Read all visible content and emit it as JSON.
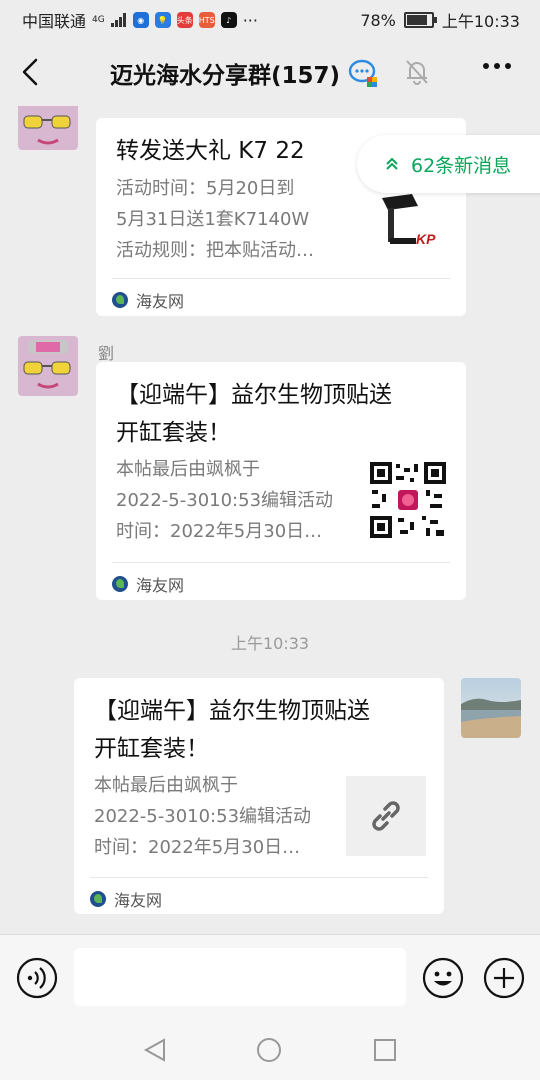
{
  "status_bar": {
    "carrier": "中国联通",
    "network": "4G",
    "app_icons": [
      "头条",
      "HTS"
    ],
    "more": "···",
    "battery_pct": "78%",
    "battery_level": 0.78,
    "time": "上午10:33"
  },
  "header": {
    "back_icon": "back-arrow-icon",
    "title": "迈光海水分享群(157)",
    "group_icon": "group-chat-icon",
    "mute_icon": "bell-off-icon",
    "more_icon": "more-dots-icon"
  },
  "new_messages": {
    "label": "62条新消息",
    "icon": "double-chevron-up-icon",
    "color": "#0aa65a"
  },
  "messages": [
    {
      "sender": "",
      "title": "转发送大礼 K7 22",
      "desc": [
        "活动时间：5月20日到",
        "5月31日送1套K7140W",
        "活动规则：把本贴活动…"
      ],
      "thumb_text": "KP",
      "source": "海友网"
    },
    {
      "sender": "劉",
      "title": [
        "【迎端午】益尔生物顶贴送",
        "开缸套装！"
      ],
      "desc": [
        "本帖最后由飒枫于",
        "2022-5-3010:53编辑活动",
        "时间：2022年5月30日…"
      ],
      "thumb": "qr-code",
      "source": "海友网"
    }
  ],
  "timestamp": "上午10:33",
  "my_message": {
    "title": [
      "【迎端午】益尔生物顶贴送",
      "开缸套装！"
    ],
    "desc": [
      "本帖最后由飒枫于",
      "2022-5-3010:53编辑活动",
      "时间：2022年5月30日…"
    ],
    "thumb_icon": "link-icon",
    "source": "海友网"
  },
  "input_bar": {
    "voice_icon": "voice-icon",
    "input_value": "",
    "emoji_icon": "emoji-icon",
    "plus_icon": "plus-icon"
  },
  "nav_bar": {
    "icons": [
      "nav-back-icon",
      "nav-home-icon",
      "nav-recent-icon"
    ]
  }
}
